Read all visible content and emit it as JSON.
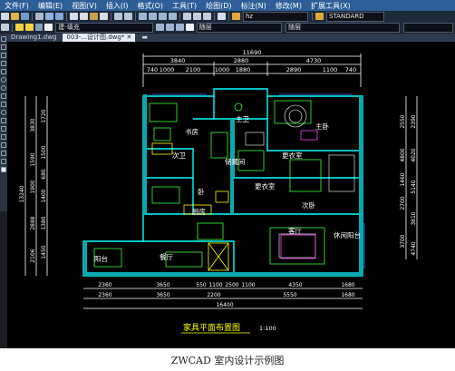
{
  "menu": [
    "文件(F)",
    "编辑(E)",
    "视图(V)",
    "插入(I)",
    "格式(O)",
    "工具(T)",
    "绘图(D)",
    "标注(N)",
    "修改(M)",
    "扩展工具(X)"
  ],
  "toolbar": {
    "layer_value": "建-填充",
    "layer_value2": "随层",
    "linetype_value": "随层",
    "font_value": "hz",
    "style_value": "STANDARD"
  },
  "tabs": [
    "Drawing1.dwg",
    "003-...设计图.dwg*"
  ],
  "icons": {
    "tab_close": "close-icon",
    "new_tab": "new-tab-icon",
    "menu_icon": "app-menu-icon"
  },
  "dims": {
    "top1": [
      "11690"
    ],
    "top2": [
      "3840",
      "2880",
      "4730"
    ],
    "top3": [
      "740",
      "1000",
      "2100",
      "1000",
      "1880",
      "2890",
      "1100",
      "740"
    ],
    "bottom1": [
      "2360",
      "3650",
      "550",
      "1100",
      "2500",
      "1100",
      "4350",
      "1680"
    ],
    "bottom2": [
      "2360",
      "3650",
      "2200",
      "5550",
      "1680"
    ],
    "bottom3": [
      "16400"
    ],
    "left1": [
      "13240"
    ],
    "left2": [
      "3830",
      "1590",
      "1900",
      "2888",
      "2106"
    ],
    "left3": [
      "1720",
      "1500",
      "680",
      "1400",
      "1380",
      "1450"
    ],
    "right1": [
      "2550",
      "4800",
      "1460",
      "2700",
      "3700"
    ],
    "right2": [
      "2390",
      "4020",
      "5140",
      "3810",
      "4740"
    ]
  },
  "rooms": [
    "主卫",
    "主卧",
    "书房",
    "次卫",
    "储藏间",
    "更衣室",
    "更衣室",
    "卧",
    "厨房",
    "次卧",
    "客厅",
    "休闲阳台",
    "阳台",
    "餐厅"
  ],
  "plan_title": "家具平面布置图",
  "plan_scale": "1:100",
  "caption": "ZWCAD 室内设计示例图"
}
